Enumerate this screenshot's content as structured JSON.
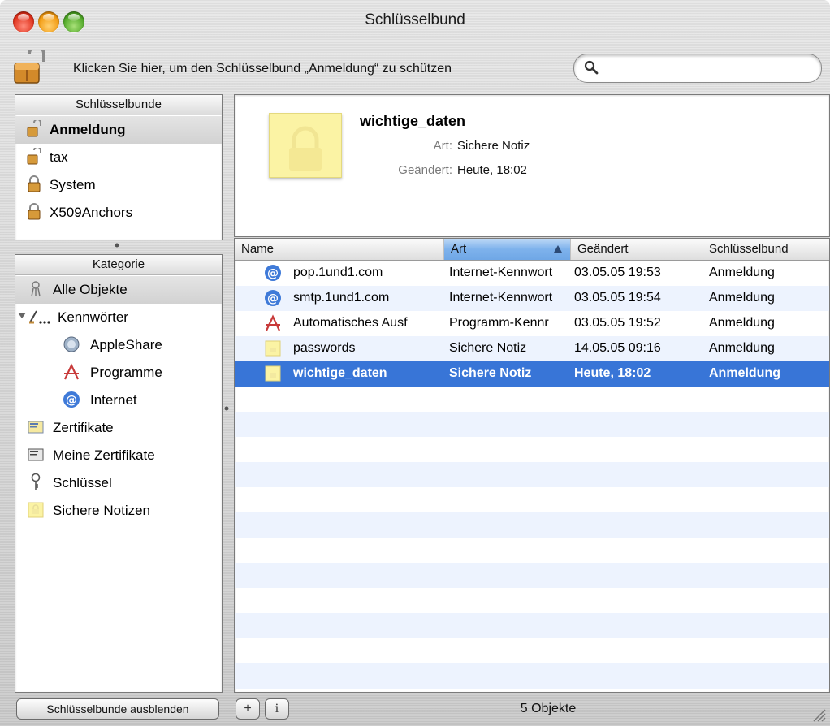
{
  "window": {
    "title": "Schlüsselbund"
  },
  "toolbar": {
    "message": "Klicken Sie hier, um den Schlüsselbund „Anmeldung“ zu schützen",
    "search_placeholder": ""
  },
  "keychains": {
    "header": "Schlüsselbunde",
    "items": [
      {
        "label": "Anmeldung",
        "icon": "unlocked-lock-icon",
        "selected": true
      },
      {
        "label": "tax",
        "icon": "unlocked-lock-icon"
      },
      {
        "label": "System",
        "icon": "locked-lock-icon"
      },
      {
        "label": "X509Anchors",
        "icon": "locked-lock-icon"
      }
    ]
  },
  "category": {
    "header": "Kategorie",
    "items": [
      {
        "label": "Alle Objekte",
        "icon": "all-items-icon",
        "selected": true
      },
      {
        "label": "Kennwörter",
        "icon": "passwords-icon",
        "expanded": true
      },
      {
        "label": "AppleShare",
        "icon": "appleshare-icon"
      },
      {
        "label": "Programme",
        "icon": "applications-icon"
      },
      {
        "label": "Internet",
        "icon": "internet-at-icon"
      },
      {
        "label": "Zertifikate",
        "icon": "certificate-icon"
      },
      {
        "label": "Meine Zertifikate",
        "icon": "my-certificate-icon"
      },
      {
        "label": "Schlüssel",
        "icon": "key-icon"
      },
      {
        "label": "Sichere Notizen",
        "icon": "secure-note-icon"
      }
    ]
  },
  "detail": {
    "name": "wichtige_daten",
    "art_label": "Art:",
    "art_value": "Sichere Notiz",
    "changed_label": "Geändert:",
    "changed_value": "Heute, 18:02"
  },
  "table": {
    "columns": [
      "Name",
      "Art",
      "Geändert",
      "Schlüsselbund"
    ],
    "sorted_column": "Art",
    "rows": [
      {
        "name": "pop.1und1.com",
        "art": "Internet-Kennwort",
        "changed": "03.05.05 19:53",
        "keychain": "Anmeldung",
        "icon": "internet-at-icon"
      },
      {
        "name": "smtp.1und1.com",
        "art": "Internet-Kennwort",
        "changed": "03.05.05 19:54",
        "keychain": "Anmeldung",
        "icon": "internet-at-icon"
      },
      {
        "name": "Automatisches Ausf",
        "art": "Programm-Kennr",
        "changed": "03.05.05 19:52",
        "keychain": "Anmeldung",
        "icon": "applications-icon"
      },
      {
        "name": "passwords",
        "art": "Sichere Notiz",
        "changed": "14.05.05 09:16",
        "keychain": "Anmeldung",
        "icon": "secure-note-icon"
      },
      {
        "name": "wichtige_daten",
        "art": "Sichere Notiz",
        "changed": "Heute, 18:02",
        "keychain": "Anmeldung",
        "icon": "secure-note-icon",
        "selected": true
      }
    ]
  },
  "bottom": {
    "hide_button": "Schlüsselbunde ausblenden",
    "add_button": "+",
    "info_button": "i",
    "count": "5 Objekte"
  },
  "colors": {
    "selection": "#3875d7",
    "alt_row": "#edf3fe",
    "note": "#fbf3a4"
  }
}
